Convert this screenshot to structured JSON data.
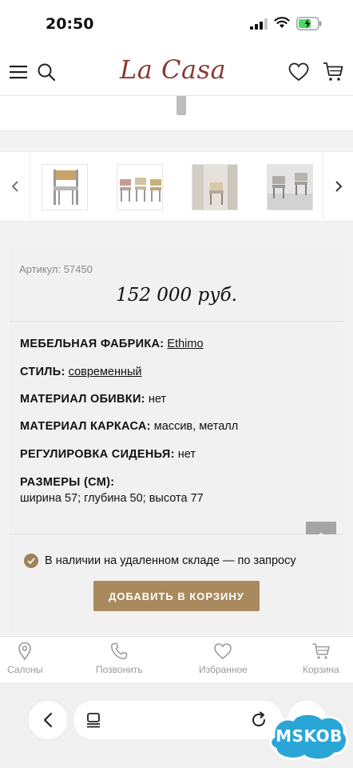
{
  "status_bar": {
    "time": "20:50"
  },
  "header": {
    "logo": "La Casa"
  },
  "product": {
    "article": "Артикул: 57450",
    "price": "152 000 руб."
  },
  "specs": {
    "factory_label": "МЕБЕЛЬНАЯ ФАБРИКА:",
    "factory_value": "Ethimo",
    "style_label": "СТИЛЬ:",
    "style_value": "современный",
    "upholstery_label": "МАТЕРИАЛ ОБИВКИ:",
    "upholstery_value": "нет",
    "frame_label": "МАТЕРИАЛ КАРКАСА:",
    "frame_value": "массив, металл",
    "seat_label": "РЕГУЛИРОВКА СИДЕНЬЯ:",
    "seat_value": "нет",
    "size_label": "РАЗМЕРЫ (СМ):",
    "size_value": "ширина 57; глубина 50; высота 77"
  },
  "stock": {
    "text": "В наличии на удаленном складе — по запросу",
    "add_button": "ДОБАВИТЬ В КОРЗИНУ"
  },
  "bottom_nav": {
    "salons": "Салоны",
    "call": "Позвонить",
    "favorites": "Избранное",
    "cart": "Корзина"
  },
  "watermark": "MSKOB",
  "colors": {
    "brand": "#8a3a35",
    "accent": "#a98a5e",
    "check": "#9e8258"
  },
  "icons": {
    "menu": "menu-icon",
    "search": "search-icon",
    "favorites": "heart-icon",
    "cart": "cart-icon",
    "location": "location-pin-icon",
    "phone": "phone-icon",
    "back": "chevron-left-icon",
    "tabs": "tabs-icon",
    "reload": "reload-icon",
    "scroll_top": "chevron-up-icon"
  }
}
